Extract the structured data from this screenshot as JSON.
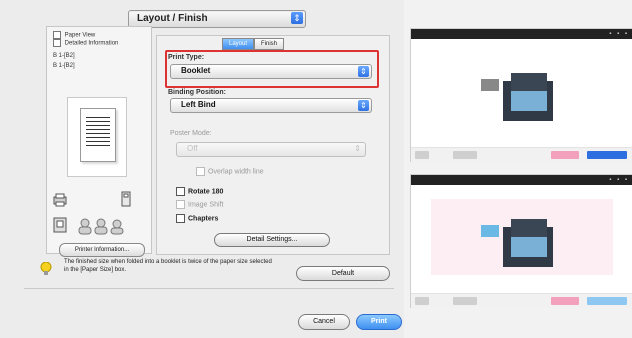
{
  "dialog": {
    "top_menu": "Layout / Finish",
    "left_options": [
      "Paper View",
      "Detailed Information"
    ],
    "left_size_lines": [
      "B 1-[B2]",
      "B 1-[B2]"
    ],
    "printer_info_label": "Printer Information...",
    "tabs": [
      "Layout",
      "Finish"
    ],
    "print_type_label": "Print Type:",
    "print_type_value": "Booklet",
    "binding_label": "Binding Position:",
    "binding_value": "Left Bind",
    "poster_mode_label": "Poster Mode:",
    "poster_mode_value": "Off",
    "overlap_label": "Overlap width line",
    "rotate_label": "Rotate 180",
    "image_shift_label": "Image Shift",
    "chapters_label": "Chapters",
    "detail_settings_label": "Detail Settings...",
    "note_text": "The finished size when folded into a booklet is twice of the paper size selected in the [Paper Size] box.",
    "default_label": "Default",
    "cancel_label": "Cancel",
    "print_label": "Print"
  },
  "colors": {
    "blue_accent": "#2d6ee0",
    "highlight_red": "#d33",
    "pink": "#f2a0bb",
    "light_blue": "#8ec8f2"
  }
}
